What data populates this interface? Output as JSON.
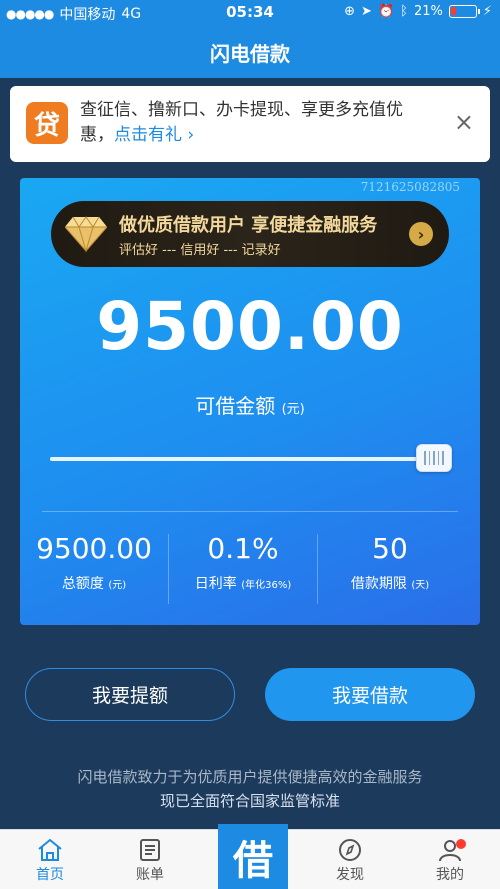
{
  "status_bar": {
    "signal": "●●●●●",
    "carrier": "中国移动",
    "network": "4G",
    "time": "05:34",
    "battery": "21%"
  },
  "nav": {
    "title": "闪电借款"
  },
  "notice": {
    "icon_text": "贷",
    "text": "查征信、撸新口、办卡提现、享更多充值优惠，",
    "link": "点击有礼 ›",
    "close": "×"
  },
  "card": {
    "code": "7121625082805",
    "vip_title": "做优质借款用户  享便捷金融服务",
    "vip_sub": "评估好 --- 信用好 --- 记录好",
    "vip_arrow": "›",
    "amount": "9500.00",
    "amount_label": "可借金额",
    "amount_unit": "(元)",
    "slider_value": 1.0,
    "stats": [
      {
        "value": "9500.00",
        "label": "总额度",
        "unit": "(元)"
      },
      {
        "value": "0.1%",
        "label": "日利率",
        "unit": "(年化36%)"
      },
      {
        "value": "50",
        "label": "借款期限",
        "unit": "(天)"
      }
    ]
  },
  "buttons": {
    "raise_limit": "我要提额",
    "borrow": "我要借款"
  },
  "footer": {
    "line1": "闪电借款致力于为优质用户提供便捷高效的金融服务",
    "line2": "现已全面符合国家监管标准"
  },
  "tabs": {
    "home": "首页",
    "bill": "账单",
    "center": "借",
    "discover": "发现",
    "mine": "我的"
  },
  "colors": {
    "brand": "#1e8be2",
    "card_gradient_start": "#1aa8f2",
    "gold": "#f3d89c"
  }
}
